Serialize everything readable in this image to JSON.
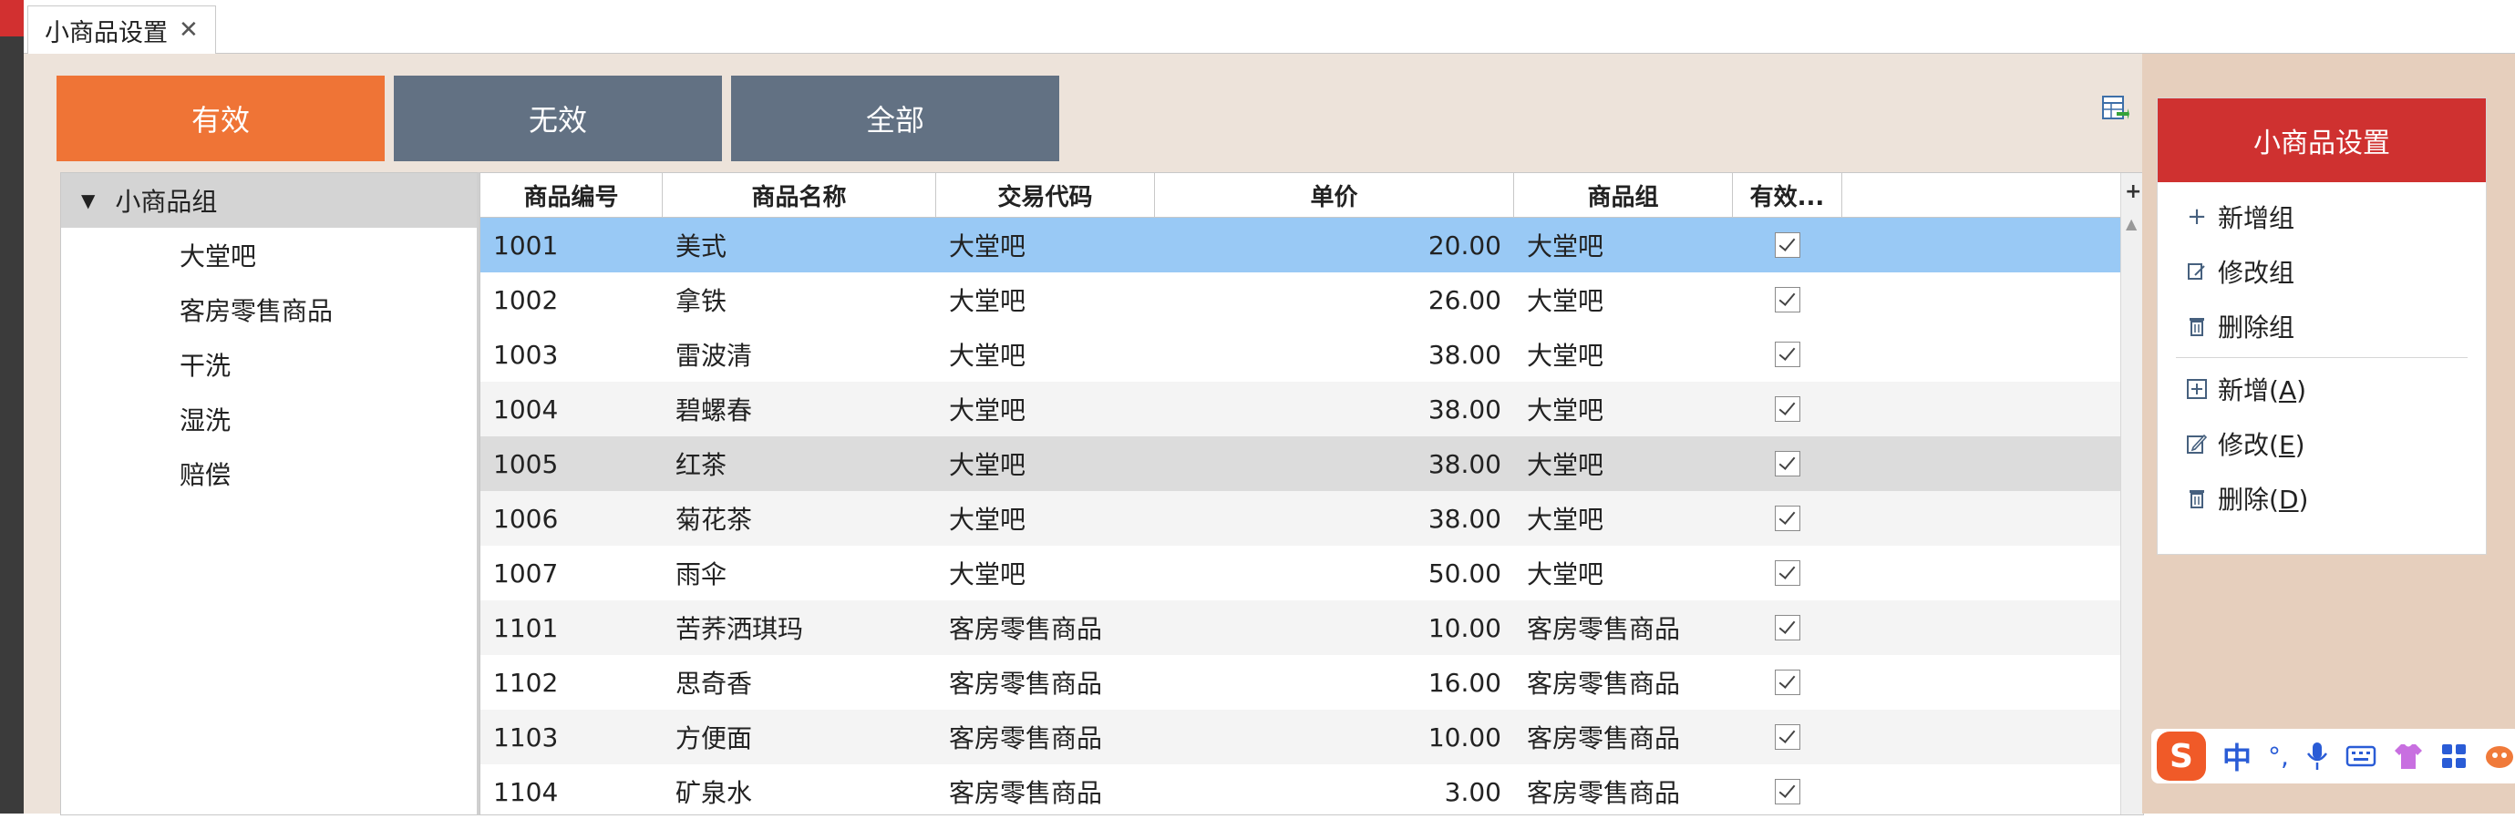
{
  "tab": {
    "label": "小商品设置",
    "close": "✕"
  },
  "filters": {
    "valid": "有效",
    "invalid": "无效",
    "all": "全部"
  },
  "tree": {
    "root": "小商品组",
    "items": [
      "大堂吧",
      "客房零售商品",
      "干洗",
      "湿洗",
      "赔偿"
    ]
  },
  "grid": {
    "columns": [
      "商品编号",
      "商品名称",
      "交易代码",
      "单价",
      "商品组",
      "有效..."
    ],
    "rows": [
      {
        "code": "1001",
        "name": "美式",
        "trade": "大堂吧",
        "price": "20.00",
        "group": "大堂吧",
        "valid": true
      },
      {
        "code": "1002",
        "name": "拿铁",
        "trade": "大堂吧",
        "price": "26.00",
        "group": "大堂吧",
        "valid": true
      },
      {
        "code": "1003",
        "name": "雷波清",
        "trade": "大堂吧",
        "price": "38.00",
        "group": "大堂吧",
        "valid": true
      },
      {
        "code": "1004",
        "name": "碧螺春",
        "trade": "大堂吧",
        "price": "38.00",
        "group": "大堂吧",
        "valid": true
      },
      {
        "code": "1005",
        "name": "红茶",
        "trade": "大堂吧",
        "price": "38.00",
        "group": "大堂吧",
        "valid": true
      },
      {
        "code": "1006",
        "name": "菊花茶",
        "trade": "大堂吧",
        "price": "38.00",
        "group": "大堂吧",
        "valid": true
      },
      {
        "code": "1007",
        "name": "雨伞",
        "trade": "大堂吧",
        "price": "50.00",
        "group": "大堂吧",
        "valid": true
      },
      {
        "code": "1101",
        "name": "苦荞洒琪玛",
        "trade": "客房零售商品",
        "price": "10.00",
        "group": "客房零售商品",
        "valid": true
      },
      {
        "code": "1102",
        "name": "思奇香",
        "trade": "客房零售商品",
        "price": "16.00",
        "group": "客房零售商品",
        "valid": true
      },
      {
        "code": "1103",
        "name": "方便面",
        "trade": "客房零售商品",
        "price": "10.00",
        "group": "客房零售商品",
        "valid": true
      },
      {
        "code": "1104",
        "name": "矿泉水",
        "trade": "客房零售商品",
        "price": "3.00",
        "group": "客房零售商品",
        "valid": true
      }
    ]
  },
  "panel": {
    "title": "小商品设置",
    "add_group": "新增组",
    "edit_group": "修改组",
    "delete_group": "删除组",
    "add": "新增",
    "add_key": "A",
    "edit": "修改",
    "edit_key": "E",
    "delete": "删除",
    "delete_key": "D"
  },
  "ime": {
    "logo": "S",
    "mode": "中",
    "punct": "°,"
  }
}
